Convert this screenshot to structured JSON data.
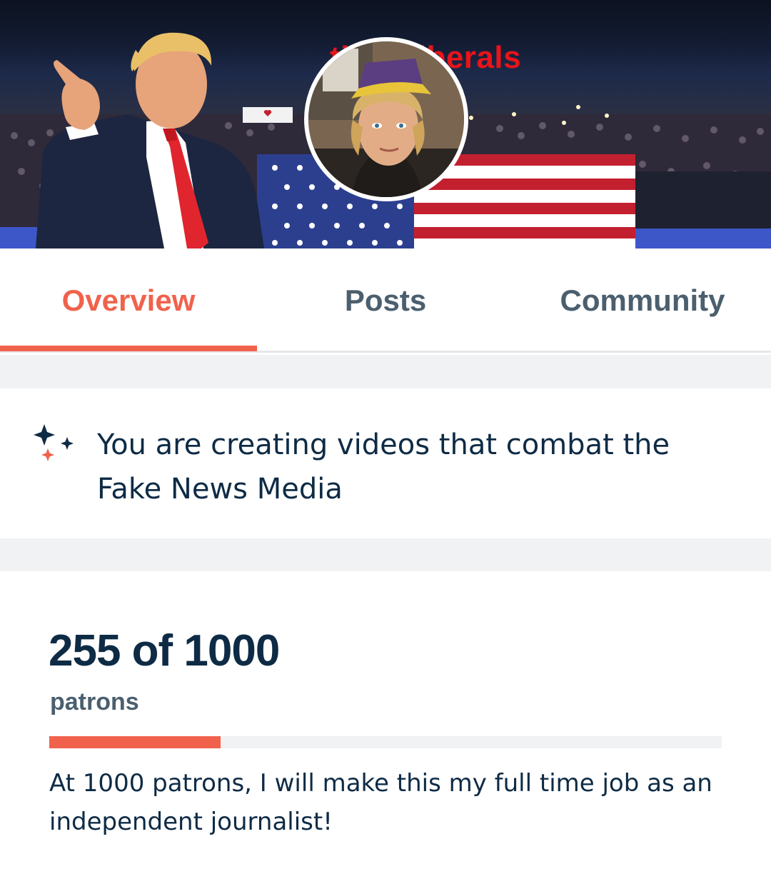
{
  "banner": {
    "title": "Triggering Liberals",
    "visible_title": "ting Liberals",
    "title_color": "#e8141a"
  },
  "tabs": [
    {
      "label": "Overview",
      "active": true
    },
    {
      "label": "Posts",
      "active": false
    },
    {
      "label": "Community",
      "active": false
    }
  ],
  "summary": {
    "icon": "sparkle-icon",
    "text": "You are creating videos that combat the Fake News Media"
  },
  "goal": {
    "count_text": "255 of 1000",
    "unit": "patrons",
    "current": 255,
    "target": 1000,
    "progress_fraction": 0.255,
    "description": "At 1000 patrons, I will make this my full time job as an independent journalist!"
  },
  "colors": {
    "accent": "#f0624c",
    "text_dark": "#0e2b45",
    "text_muted": "#4b5f6e",
    "divider": "#f1f2f3"
  }
}
